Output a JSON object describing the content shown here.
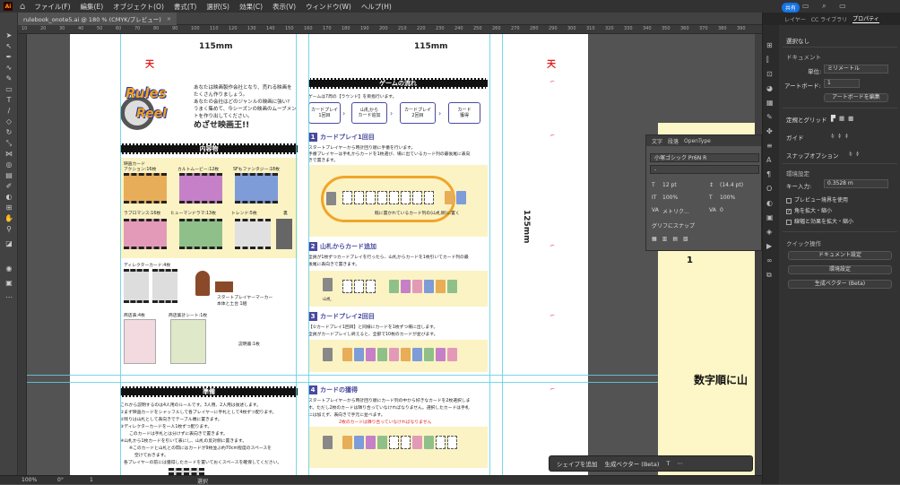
{
  "menubar": {
    "logo": "Ai",
    "items": [
      "ファイル(F)",
      "編集(E)",
      "オブジェクト(O)",
      "書式(T)",
      "選択(S)",
      "効果(C)",
      "表示(V)",
      "ウィンドウ(W)",
      "ヘルプ(H)"
    ],
    "share": "共有"
  },
  "document": {
    "tab_title": "rulebook_onote5.ai @ 180 % (CMYK/プレビュー)",
    "zoom": "100%",
    "angle": "0°",
    "artboard_nav": "1",
    "status_mode": "選択"
  },
  "ruler": {
    "ticks": [
      "10",
      "20",
      "30",
      "40",
      "50",
      "60",
      "70",
      "80",
      "90",
      "100",
      "110",
      "120",
      "130",
      "140",
      "150",
      "160",
      "170",
      "180",
      "190",
      "200",
      "210",
      "220",
      "230",
      "240",
      "250",
      "260",
      "270",
      "280",
      "290",
      "300",
      "310",
      "320",
      "330",
      "340",
      "350",
      "360",
      "370",
      "380",
      "390"
    ]
  },
  "artboard": {
    "dim_left": "115mm",
    "dim_right": "115mm",
    "dim_vertical": "125mm",
    "ten_mark": "天",
    "logo_line1": "Rules",
    "logo_line2": "Reel",
    "intro_lines": [
      "あなたは映画製作会社となり、売れる映画を",
      "たくさん作りましょう。",
      "あなたの会社はどのジャンルの映画に強い?",
      "うまく集めて、今シーズンの映画のムーブメン",
      "トを作り出してください。"
    ],
    "intro_big": "めざせ映画王!!",
    "contents_title": "内容物",
    "movie_cards_label": "映画カード",
    "genres": [
      "アクション:16枚",
      "カルトムービー:12枚",
      "SFもファンタジー:18枚",
      "ラブロマンス:16枚",
      "ヒューマンドラマ:13枚",
      "トレンド:5枚",
      "裏"
    ],
    "director_cards": "ディレクターカード:4枚",
    "start_marker_1": "スタートプレイヤーマーカー",
    "start_marker_2": "本体と土台 1組",
    "shop_table": "商店表:4枚",
    "score_sheet": "商店集計シート:1枚",
    "rulebook": "説明書:1枚",
    "prep_title": "準備",
    "prep_lines": [
      "これから説明するのは4人用のルールです。3人用、2人用は後述します。",
      "①まず映画カードをシャッフルして各プレイヤーに手札として4枚ずつ配ります。",
      "②残りは山札として表向きでテーブル端に置きます。",
      "③ディレクターカードを一人1枚ずつ配ります。",
      "このカードは手札とは分けずに表向きで置きます。",
      "④山札から1枚カードを引いて表にし、山札の反対側に置きます。",
      "※このカードと山札との間にはカードが9枚並ぶ約70cm程度のスペースを",
      "空けておきます。",
      "各プレイヤーの前には獲得したカードを置いておくスペースを確保してください。"
    ],
    "flow_title": "ゲームの流れ",
    "flow_intro": "ゲームは7周の【ラウンド】を目指行います。",
    "flow_steps": [
      "カードプレイ\n1回目",
      "山札から\nカード追加",
      "カードプレイ\n2回目",
      "カード\n獲得"
    ],
    "step1_title": "カードプレイ1回目",
    "step1_lines": [
      "スタートプレイヤーから時計回り順に手番を行います。",
      "手番プレイヤーは手札からカードを1枚選び、場に出ているカード列の最後尾に表向",
      "きで置きます。"
    ],
    "step1_note": "既に置かれているカード列の(山札側)に置く",
    "step2_title": "山札からカード追加",
    "step2_lines": [
      "全員が1枚ずつカードプレイを行ったら、山札からカードを1枚引いてカード列の最",
      "後尾に表向きで置きます。"
    ],
    "step2_note": "山札",
    "step3_title": "カードプレイ2回目",
    "step3_lines": [
      "【①カードプレイ1回目】と同様にカードを1枚ずつ場に出します。",
      "全員がカードプレイし終えると、全部で10枚のカードが並びます。"
    ],
    "step4_title": "カードの獲得",
    "step4_lines": [
      "スタートプレイヤーから時計回り順にカード列の中から好きなカードを2枚選択しま",
      "す。ただし2枚のカードは隣り合っていなければなりません。選択したカードは手札",
      "には加えず、表向きで手元に並べます。"
    ],
    "step4_warn": "2枚のカードは隣り合っていなければなりません"
  },
  "right_artboard": {
    "page_num": "1",
    "jp_text": "数字順に山"
  },
  "char_panel": {
    "tabs": [
      "文字",
      "段落",
      "OpenType"
    ],
    "font": "小塚ゴシック Pr6N R",
    "style": "-",
    "size": "12 pt",
    "leading": "(14.4 pt)",
    "hscale": "100%",
    "vscale": "100%",
    "kerning": "メトリク...",
    "tracking": "0",
    "snap": "グリフにスナップ"
  },
  "context_bar": {
    "add_shape": "シェイプを追加",
    "gen_vector": "生成ベクター (Beta)"
  },
  "properties": {
    "tabs": [
      "レイヤー",
      "CC ライブラリ",
      "プロパティ"
    ],
    "no_selection": "選択なし",
    "document_hd": "ドキュメント",
    "unit_label": "単位:",
    "unit_value": "ミリメートル",
    "artboard_label": "アートボード:",
    "artboard_value": "1",
    "edit_artboard": "アートボードを編集",
    "rulers_grids": "定規とグリッド",
    "guides": "ガイド",
    "snap_options": "スナップオプション",
    "prefs_hd": "環境設定",
    "key_input_label": "キー入力:",
    "key_input_value": "0.3528 m",
    "chk_preview": "プレビュー境界を使用",
    "chk_scale_corners": "角を拡大・縮小",
    "chk_scale_strokes": "線幅と効果を拡大・縮小",
    "quick_actions": "クイック操作",
    "btn_doc_setup": "ドキュメント設定",
    "btn_prefs": "環境設定",
    "btn_gen_vector": "生成ベクター (Beta)"
  }
}
